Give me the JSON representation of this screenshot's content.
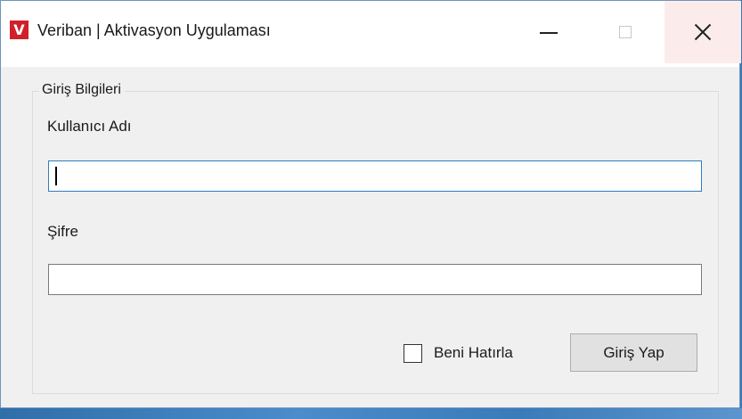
{
  "window": {
    "title": "Veriban | Aktivasyon Uygulaması",
    "app_icon_letter": "V",
    "app_icon_color": "#d0202a",
    "controls": {
      "minimize_icon": "minimize-icon",
      "maximize_icon": "maximize-icon",
      "close_icon": "close-icon"
    }
  },
  "login_group": {
    "legend": "Giriş Bilgileri",
    "username": {
      "label": "Kullanıcı Adı",
      "value": "",
      "focused": true
    },
    "password": {
      "label": "Şifre",
      "value": ""
    },
    "remember_me": {
      "label": "Beni Hatırla",
      "checked": false
    },
    "submit_label": "Giriş Yap"
  },
  "colors": {
    "focus_border": "#2f7dbf",
    "close_hover": "#fbeceb",
    "desktop": "#3b79b8"
  }
}
